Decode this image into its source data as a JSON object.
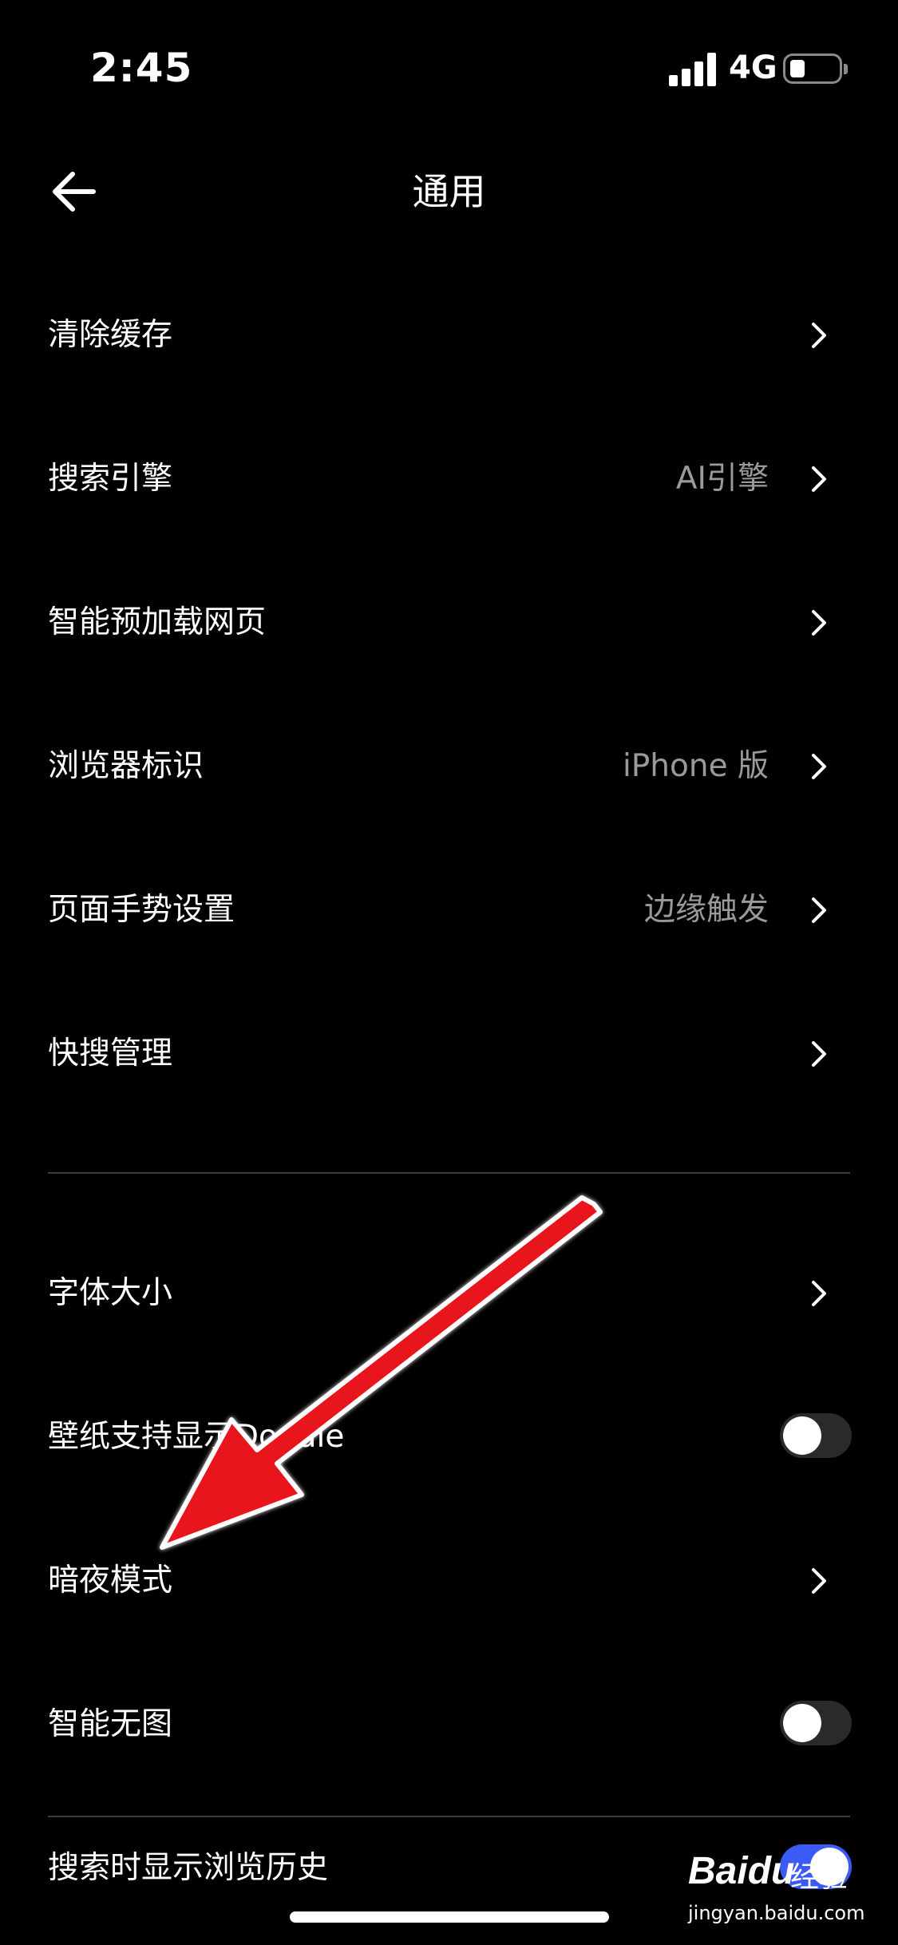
{
  "status_bar": {
    "time": "2:45",
    "network": "4G"
  },
  "header": {
    "title": "通用",
    "back_icon": "arrow-left-icon"
  },
  "settings": {
    "clear_cache": {
      "label": "清除缓存"
    },
    "search_engine": {
      "label": "搜索引擎",
      "value": "AI引擎"
    },
    "preload_pages": {
      "label": "智能预加载网页"
    },
    "browser_ua": {
      "label": "浏览器标识",
      "value": "iPhone 版"
    },
    "page_gesture": {
      "label": "页面手势设置",
      "value": "边缘触发"
    },
    "quick_search": {
      "label": "快搜管理"
    },
    "font_size": {
      "label": "字体大小"
    },
    "doodle_wallpaper": {
      "label": "壁纸支持显示Doodle",
      "enabled": false
    },
    "dark_mode": {
      "label": "暗夜模式"
    },
    "smart_no_image": {
      "label": "智能无图",
      "enabled": false
    },
    "show_history": {
      "label": "搜索时显示浏览历史",
      "enabled": true
    }
  },
  "watermark": {
    "brand": "Baidu",
    "brand_cn": "经验",
    "domain": "jingyan.baidu.com"
  },
  "colors": {
    "background": "#000000",
    "text": "#ffffff",
    "secondary_text": "#9a9a9a",
    "toggle_on": "#3b5bf6",
    "annotation_arrow": "#e8141b"
  }
}
